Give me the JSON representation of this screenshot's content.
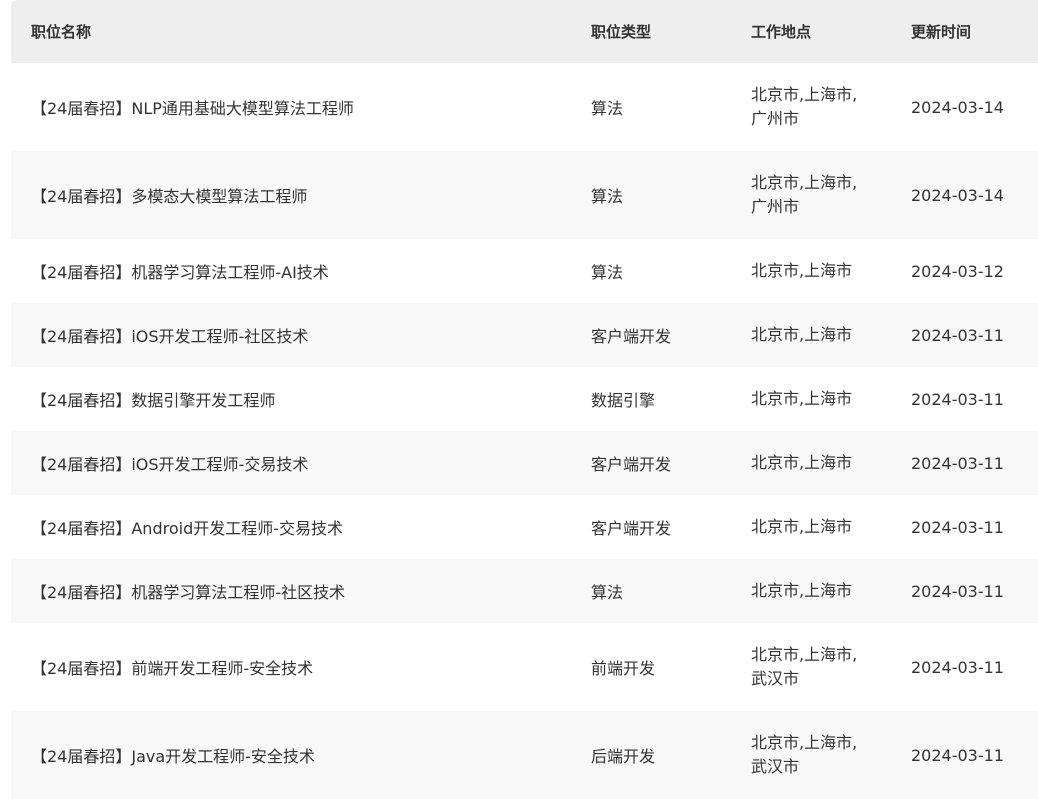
{
  "columns": {
    "name": "职位名称",
    "type": "职位类型",
    "location": "工作地点",
    "updated": "更新时间"
  },
  "jobs": [
    {
      "name": "【24届春招】NLP通用基础大模型算法工程师",
      "type": "算法",
      "location": "北京市,上海市,\n广州市",
      "updated": "2024-03-14"
    },
    {
      "name": "【24届春招】多模态大模型算法工程师",
      "type": "算法",
      "location": "北京市,上海市,\n广州市",
      "updated": "2024-03-14"
    },
    {
      "name": "【24届春招】机器学习算法工程师-AI技术",
      "type": "算法",
      "location": "北京市,上海市",
      "updated": "2024-03-12"
    },
    {
      "name": "【24届春招】iOS开发工程师-社区技术",
      "type": "客户端开发",
      "location": "北京市,上海市",
      "updated": "2024-03-11"
    },
    {
      "name": "【24届春招】数据引擎开发工程师",
      "type": "数据引擎",
      "location": "北京市,上海市",
      "updated": "2024-03-11"
    },
    {
      "name": "【24届春招】iOS开发工程师-交易技术",
      "type": "客户端开发",
      "location": "北京市,上海市",
      "updated": "2024-03-11"
    },
    {
      "name": "【24届春招】Android开发工程师-交易技术",
      "type": "客户端开发",
      "location": "北京市,上海市",
      "updated": "2024-03-11"
    },
    {
      "name": "【24届春招】机器学习算法工程师-社区技术",
      "type": "算法",
      "location": "北京市,上海市",
      "updated": "2024-03-11"
    },
    {
      "name": "【24届春招】前端开发工程师-安全技术",
      "type": "前端开发",
      "location": "北京市,上海市,\n武汉市",
      "updated": "2024-03-11"
    },
    {
      "name": "【24届春招】Java开发工程师-安全技术",
      "type": "后端开发",
      "location": "北京市,上海市,\n武汉市",
      "updated": "2024-03-11"
    }
  ]
}
